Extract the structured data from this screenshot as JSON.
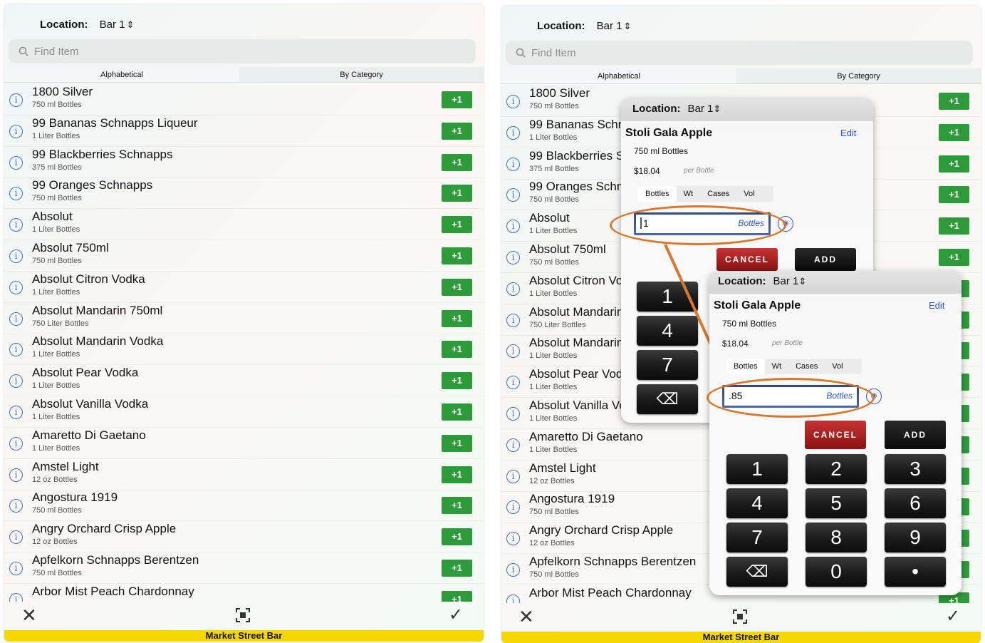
{
  "header": {
    "location_label": "Location:",
    "location_value": "Bar 1"
  },
  "search": {
    "placeholder": "Find Item"
  },
  "tabs": {
    "alphabetical": "Alphabetical",
    "by_category": "By Category"
  },
  "plus_label": "+1",
  "items": [
    {
      "name": "1800 Silver",
      "size": "750 ml Bottles"
    },
    {
      "name": "99 Bananas Schnapps Liqueur",
      "size": "1 Liter Bottles"
    },
    {
      "name": "99 Blackberries Schnapps",
      "size": "375 ml Bottles"
    },
    {
      "name": "99 Oranges Schnapps",
      "size": "750 ml Bottles"
    },
    {
      "name": "Absolut",
      "size": "1 Liter Bottles"
    },
    {
      "name": "Absolut 750ml",
      "size": "750 ml Bottles"
    },
    {
      "name": "Absolut Citron Vodka",
      "size": "1 Liter Bottles"
    },
    {
      "name": "Absolut Mandarin 750ml",
      "size": "750 Liter Bottles"
    },
    {
      "name": "Absolut Mandarin Vodka",
      "size": "1 Liter Bottles"
    },
    {
      "name": "Absolut Pear Vodka",
      "size": "1 Liter Bottles"
    },
    {
      "name": "Absolut Vanilla Vodka",
      "size": "1 Liter Bottles"
    },
    {
      "name": "Amaretto Di Gaetano",
      "size": "1 Liter Bottles"
    },
    {
      "name": "Amstel Light",
      "size": "12 oz Bottles"
    },
    {
      "name": "Angostura 1919",
      "size": "750 ml Bottles"
    },
    {
      "name": "Angry Orchard Crisp Apple",
      "size": "12 oz Bottles"
    },
    {
      "name": "Apfelkorn Schnapps Berentzen",
      "size": "750 ml Bottles"
    },
    {
      "name": "Arbor Mist Peach Chardonnay",
      "size": ""
    }
  ],
  "footer": "Market Street Bar",
  "popup": {
    "location_label": "Location:",
    "location_value": "Bar 1",
    "item_name": "Stoli Gala Apple",
    "edit": "Edit",
    "size": "750 ml Bottles",
    "price": "$18.04",
    "per": "per Bottle",
    "tabs": [
      "Bottles",
      "Wt",
      "Cases",
      "Vol"
    ],
    "unit": "Bottles",
    "value_first": "1",
    "value_second": ".85",
    "cancel": "CANCEL",
    "add": "ADD",
    "keys": [
      "1",
      "2",
      "3",
      "4",
      "5",
      "6",
      "7",
      "8",
      "9",
      "⌫",
      "0",
      "•"
    ]
  },
  "colors": {
    "plus_green": "#2e9b3a",
    "footer_yellow": "#f6d800",
    "cancel_red": "#a81c1c",
    "accent_orange": "#d9782c",
    "link_blue": "#2b54d6"
  }
}
